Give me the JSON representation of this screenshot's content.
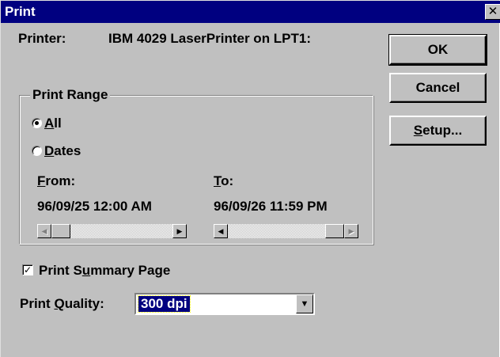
{
  "window": {
    "title": "Print",
    "close_glyph": "✕"
  },
  "printer": {
    "label": "Printer:",
    "value": "IBM 4029 LaserPrinter on LPT1:"
  },
  "buttons": {
    "ok": "OK",
    "cancel": "Cancel",
    "setup_prefix": "",
    "setup_hotkey": "S",
    "setup_rest": "etup..."
  },
  "print_range": {
    "label": "Print Range",
    "all": {
      "hotkey": "A",
      "rest": "ll",
      "selected": true
    },
    "dates": {
      "hotkey": "D",
      "rest": "ates",
      "selected": false
    },
    "from": {
      "hotkey": "F",
      "rest": "rom:",
      "value": "96/09/25 12:00 AM",
      "slider_position": "min"
    },
    "to": {
      "hotkey": "T",
      "rest": "o:",
      "value": "96/09/26 11:59 PM",
      "slider_position": "max"
    }
  },
  "summary": {
    "checked": true,
    "prefix": "Print S",
    "hotkey": "u",
    "rest": "mmary Page"
  },
  "quality": {
    "prefix": "Print ",
    "hotkey": "Q",
    "rest": "uality:",
    "selected": "300 dpi"
  },
  "icons": {
    "radio": "radio-icon",
    "checkbox_check": "✓",
    "arrow_left": "◀",
    "arrow_right": "▶",
    "arrow_down": "▼"
  },
  "colors": {
    "title_bar": "#000080",
    "dialog_face": "#c0c0c0",
    "selection": "#000080"
  }
}
